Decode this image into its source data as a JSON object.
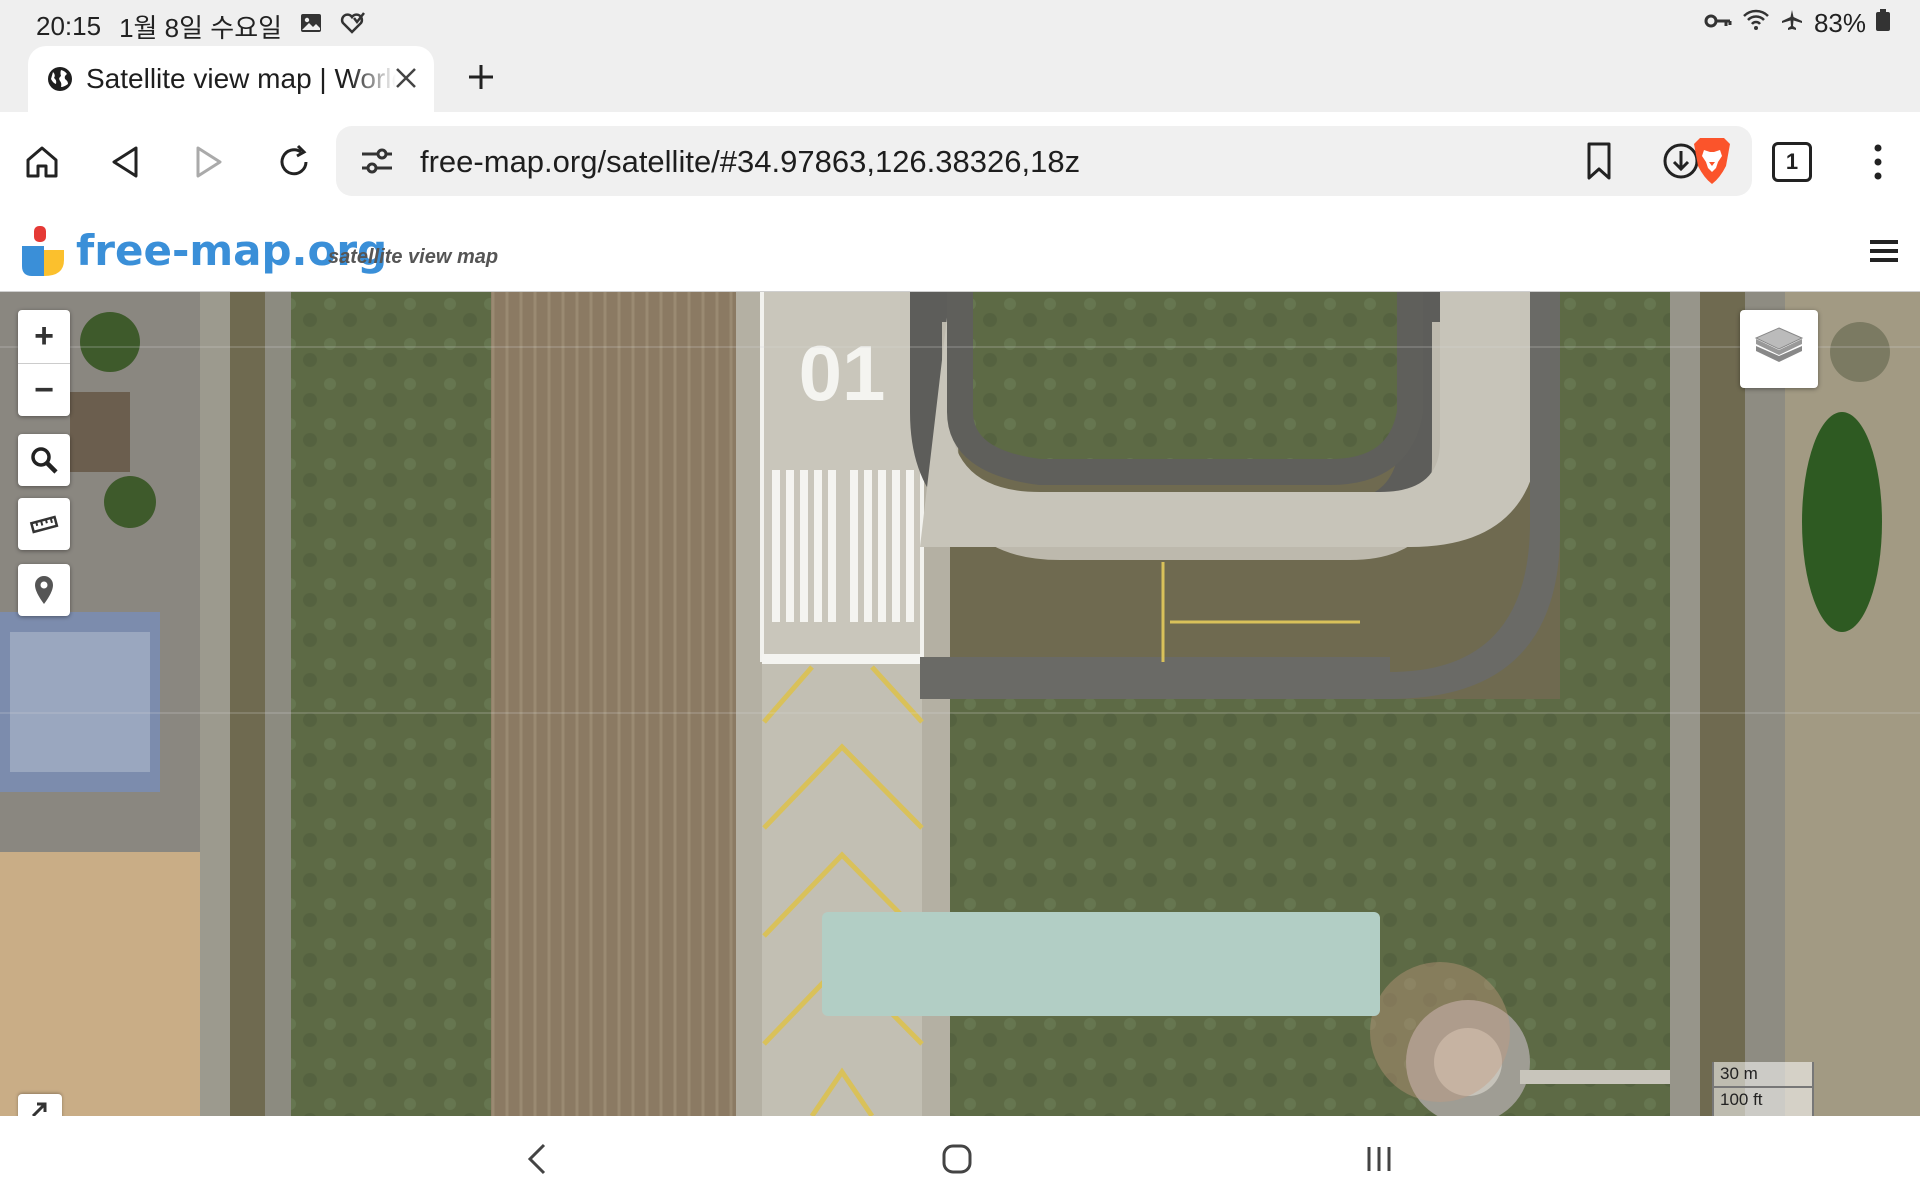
{
  "status_bar": {
    "time": "20:15",
    "date": "1월 8일 수요일",
    "battery": "83%",
    "icons": [
      "gallery-icon",
      "check-heart-icon",
      "key-icon",
      "wifi-icon",
      "airplane-icon",
      "battery-icon"
    ]
  },
  "tab": {
    "title": "Satellite view map | World",
    "icon": "globe-icon"
  },
  "toolbar": {
    "url": "free-map.org/satellite/#34.97863,126.38326,18z",
    "tab_count": "1"
  },
  "site": {
    "name": "free-map.org",
    "tagline": "satellite view map"
  },
  "map": {
    "zoom_in_label": "+",
    "zoom_out_label": "−",
    "scale_metric": "30 m",
    "scale_imperial": "100 ft",
    "runway_number": "01",
    "colors": {
      "logo_blue": "#3a8fd8",
      "ad_box": "#b2cec5"
    }
  }
}
